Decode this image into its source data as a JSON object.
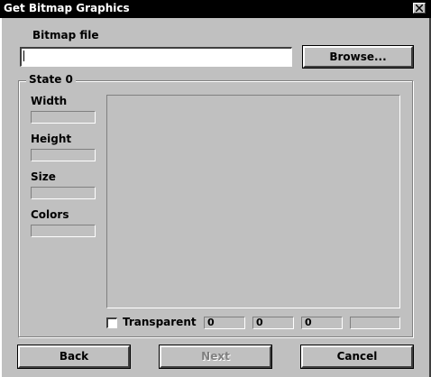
{
  "window": {
    "title": "Get Bitmap Graphics"
  },
  "bitmap_file": {
    "label": "Bitmap file",
    "value": "",
    "browse_label": "Browse..."
  },
  "state_group": {
    "legend": "State 0",
    "width": {
      "label": "Width",
      "value": ""
    },
    "height": {
      "label": "Height",
      "value": ""
    },
    "size": {
      "label": "Size",
      "value": ""
    },
    "colors": {
      "label": "Colors",
      "value": ""
    },
    "transparent": {
      "label": "Transparent",
      "checked": false
    },
    "transparent_values": [
      "0",
      "0",
      "0",
      ""
    ]
  },
  "buttons": {
    "back": "Back",
    "next": "Next",
    "cancel": "Cancel"
  },
  "icons": {
    "close": "close-icon"
  }
}
